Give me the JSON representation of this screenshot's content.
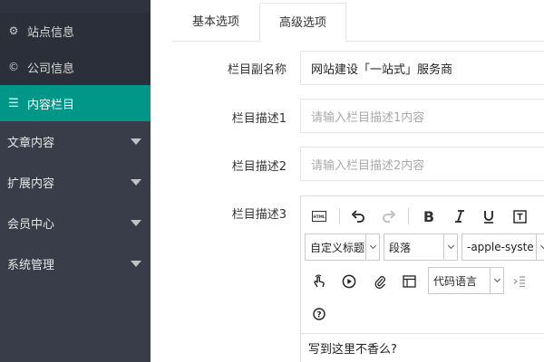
{
  "sidebar": {
    "sub_items": [
      {
        "label": "站点信息",
        "icon": "gear-icon"
      },
      {
        "label": "公司信息",
        "icon": "copyright-icon"
      }
    ],
    "active": {
      "label": "内容栏目",
      "icon": "list-icon"
    },
    "groups": [
      {
        "label": "文章内容"
      },
      {
        "label": "扩展内容"
      },
      {
        "label": "会员中心"
      },
      {
        "label": "系统管理"
      }
    ],
    "bg_color": "#393D49",
    "active_color": "#009688"
  },
  "tabs": [
    {
      "label": "基本选项",
      "active": false
    },
    {
      "label": "高级选项",
      "active": true
    }
  ],
  "form": {
    "subname": {
      "label": "栏目副名称",
      "value": "网站建设「一站式」服务商"
    },
    "desc1": {
      "label": "栏目描述1",
      "placeholder": "请输入栏目描述1内容"
    },
    "desc2": {
      "label": "栏目描述2",
      "placeholder": "请输入栏目描述2内容"
    },
    "desc3": {
      "label": "栏目描述3"
    }
  },
  "editor": {
    "toolbar_row1": [
      "html-icon",
      "undo-icon",
      "redo-icon",
      "bold-icon",
      "italic-icon",
      "underline-icon",
      "text-format-icon"
    ],
    "heading_select": "自定义标题",
    "paragraph_select": "段落",
    "font_select": "-apple-syste",
    "toolbar_row3": [
      "touch-icon",
      "play-icon",
      "attachment-icon",
      "template-icon"
    ],
    "code_language_select": "代码语言",
    "help_icon": "help-icon",
    "content": "写到这里不香么?"
  }
}
